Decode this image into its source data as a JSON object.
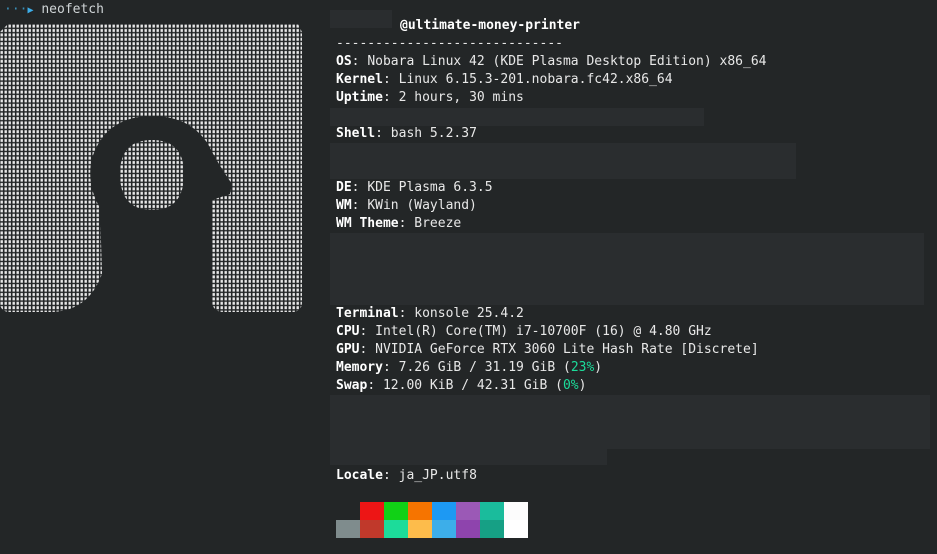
{
  "prompt": {
    "command": "neofetch"
  },
  "header": {
    "user_host": "@ultimate-money-printer",
    "separator": "-----------------------------"
  },
  "info": [
    {
      "key": "OS",
      "value": "Nobara Linux 42 (KDE Plasma Desktop Edition) x86_64"
    },
    {
      "key": "Kernel",
      "value": "Linux 6.15.3-201.nobara.fc42.x86_64"
    },
    {
      "key": "Uptime",
      "value": "2 hours, 30 mins"
    },
    {
      "key": "Shell",
      "value": "bash 5.2.37"
    },
    {
      "key": "DE",
      "value": "KDE Plasma 6.3.5"
    },
    {
      "key": "WM",
      "value": "KWin (Wayland)"
    },
    {
      "key": "WM Theme",
      "value": "Breeze"
    },
    {
      "key": "Terminal",
      "value": "konsole 25.4.2"
    },
    {
      "key": "CPU",
      "value": "Intel(R) Core(TM) i7-10700F (16) @ 4.80 GHz"
    },
    {
      "key": "GPU",
      "value": "NVIDIA GeForce RTX 3060 Lite Hash Rate [Discrete]"
    },
    {
      "key": "Memory",
      "value": "7.26 GiB / 31.19 GiB (",
      "percent": "23%",
      "close": ")"
    },
    {
      "key": "Swap",
      "value": "12.00 KiB / 42.31 GiB (",
      "percent": "0%",
      "close": ")"
    },
    {
      "key": "Locale",
      "value": "ja_JP.utf8"
    }
  ],
  "palette": {
    "top": [
      "#232627",
      "#ed1515",
      "#11d116",
      "#f67400",
      "#1d99f3",
      "#9b59b6",
      "#1abc9c",
      "#fcfcfc"
    ],
    "bottom": [
      "#7f8c8d",
      "#c0392b",
      "#1cdc9a",
      "#fdbc4b",
      "#3daee9",
      "#8e44ad",
      "#16a085",
      "#ffffff"
    ]
  }
}
